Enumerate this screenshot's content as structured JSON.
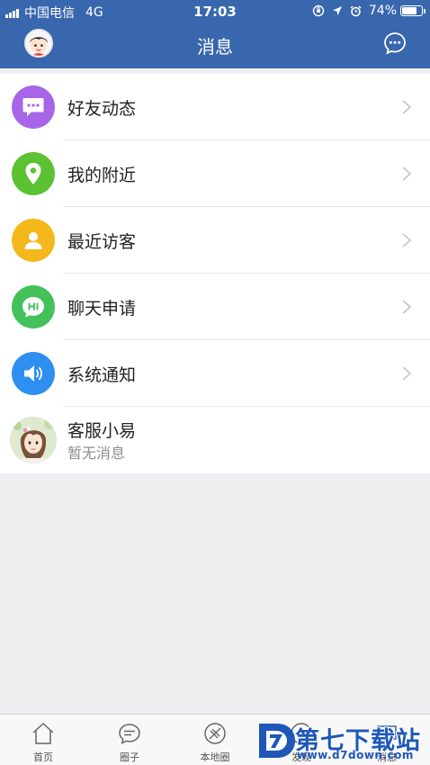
{
  "status_bar": {
    "carrier": "中国电信",
    "network": "4G",
    "time": "17:03",
    "battery": "74%",
    "battery_level": 0.74,
    "icons": [
      "orientation-lock-icon",
      "location-icon",
      "alarm-icon",
      "battery-icon"
    ]
  },
  "nav": {
    "title": "消息",
    "left_icon": "user-avatar",
    "right_icon": "chat-bubble-icon"
  },
  "list": {
    "items": [
      {
        "label": "好友动态",
        "icon": "chat-dots-icon",
        "color": "#a766e8"
      },
      {
        "label": "我的附近",
        "icon": "location-pin-icon",
        "color": "#5bc232"
      },
      {
        "label": "最近访客",
        "icon": "person-icon",
        "color": "#f5b81c"
      },
      {
        "label": "聊天申请",
        "icon": "hi-bubble-icon",
        "color": "#44c15a"
      },
      {
        "label": "系统通知",
        "icon": "speaker-icon",
        "color": "#2f8ff0"
      }
    ],
    "contact": {
      "name": "客服小易",
      "preview": "暂无消息"
    }
  },
  "tabbar": {
    "tabs": [
      {
        "label": "首页",
        "icon": "home-icon"
      },
      {
        "label": "圈子",
        "icon": "chat-bubble-icon"
      },
      {
        "label": "本地圈",
        "icon": "compass-icon"
      },
      {
        "label": "发现",
        "icon": "discover-icon"
      },
      {
        "label": "消息",
        "icon": "message-icon"
      }
    ]
  },
  "watermark": {
    "name": "第七下载站",
    "url": "www.d7down.com"
  },
  "colors": {
    "nav_bg": "#3967ad",
    "page_bg": "#efeff2",
    "watermark": "#1f57b8"
  }
}
